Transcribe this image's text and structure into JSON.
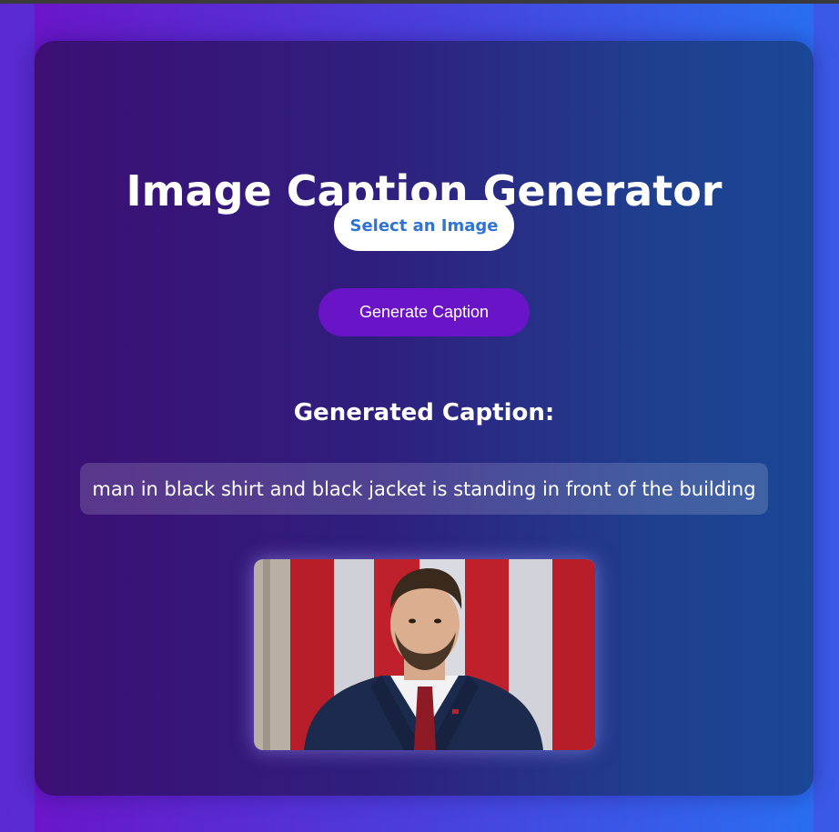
{
  "app": {
    "title": "Image Caption Generator"
  },
  "controls": {
    "select_label": "Select an Image",
    "generate_label": "Generate Caption"
  },
  "result": {
    "heading": "Generated Caption:",
    "caption": "man in black shirt and black jacket is standing in front of the building"
  },
  "preview": {
    "alt": "uploaded photo preview"
  },
  "colors": {
    "select_text": "#2f73d6",
    "generate_bg": "#6a14c8"
  }
}
